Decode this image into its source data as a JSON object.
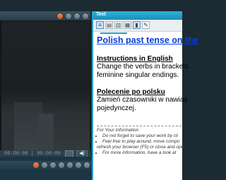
{
  "video": {
    "time_current": "00:00:00",
    "time_total": "00:00:00",
    "time_display": "00:00:00 | 00:00:00"
  },
  "text_window": {
    "title": "Text"
  },
  "toolbar": {
    "icons": [
      "list-icon",
      "doc-icon",
      "save-icon",
      "print-icon",
      "select-icon",
      "pen-icon"
    ]
  },
  "document": {
    "title": "Polish past tense on the",
    "section1_heading": "Instructions in English",
    "section1_line1": "Change the verbs in brackets",
    "section1_line2": "feminine singular endings.",
    "section2_heading": "Polecenie po polsku",
    "section2_line1": "Zamień czasowniki w nawias",
    "section2_line2": "pojedynczej.",
    "info_heading": "For Your Information",
    "info_items": [
      "Do not forget to save your work by cli",
      "Feel free to play around, move compo",
      "refresh your browser (F5) or close and ope",
      "For more information, have a look at"
    ]
  },
  "colors": {
    "accent": "#2aa0c8",
    "link": "#0a3cd8",
    "close": "#e06a30"
  }
}
